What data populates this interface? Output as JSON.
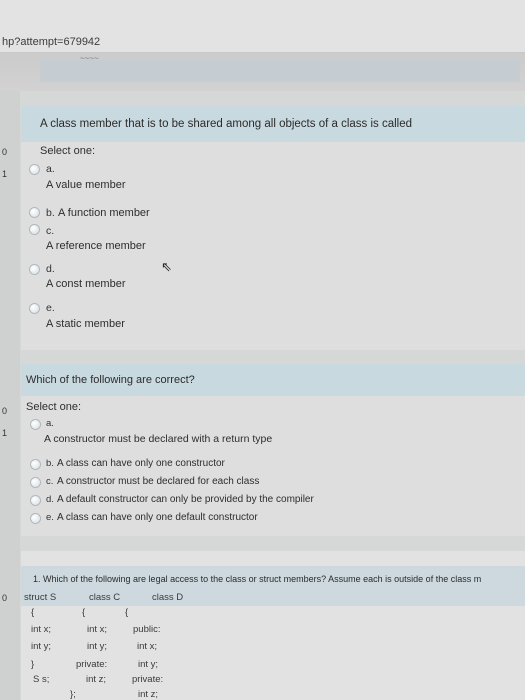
{
  "browser": {
    "url": "hp?attempt=679942"
  },
  "header": {
    "strip_label": "~~~~"
  },
  "gutter": {
    "mark_0": "0",
    "mark_1": "1"
  },
  "q1": {
    "text": "A class member that is to be shared among all objects of a class is called",
    "select_label": "Select one:",
    "options": [
      {
        "letter": "a.",
        "text": "A value member"
      },
      {
        "letter": "b.",
        "text": "A function member"
      },
      {
        "letter": "c.",
        "text": "A reference member"
      },
      {
        "letter": "d.",
        "text": "A const member"
      },
      {
        "letter": "e.",
        "text": "A static member"
      }
    ]
  },
  "q2": {
    "text": "Which of the following are correct?",
    "select_label": "Select one:",
    "options": [
      {
        "letter": "a.",
        "text": "A constructor must be declared with a return type"
      },
      {
        "letter": "b.",
        "text": "A class can have only one constructor"
      },
      {
        "letter": "c.",
        "text": "A constructor must be declared for each class"
      },
      {
        "letter": "d.",
        "text": "A default constructor can only be provided by the compiler"
      },
      {
        "letter": "e.",
        "text": "A class can have only one default constructor"
      }
    ]
  },
  "q3": {
    "text": "1. Which of the following are legal access to the class or struct members? Assume each is outside of the class m",
    "col_s": {
      "header": "struct S",
      "lines": [
        "{",
        "int x;",
        "int y;",
        "}",
        "S s;"
      ]
    },
    "col_c": {
      "header": "class C",
      "lines": [
        "{",
        "int x;",
        "int y;",
        "private:",
        "int z;",
        "};"
      ]
    },
    "col_d": {
      "header": "class D",
      "lines": [
        "{",
        "public:",
        "int x;",
        "int y;",
        "private:",
        "int z;"
      ]
    }
  }
}
